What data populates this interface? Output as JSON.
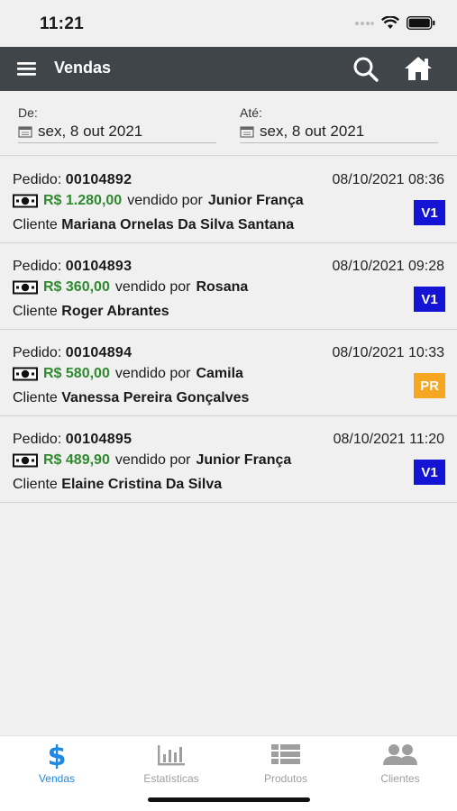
{
  "status": {
    "time": "11:21"
  },
  "header": {
    "title": "Vendas"
  },
  "filters": {
    "from": {
      "label": "De:",
      "value": "sex, 8 out 2021"
    },
    "to": {
      "label": "Até:",
      "value": "sex, 8 out 2021"
    }
  },
  "orders": [
    {
      "order_label": "Pedido:",
      "number": "00104892",
      "datetime": "08/10/2021 08:36",
      "price": "R$ 1.280,00",
      "sold_by_label": "vendido por",
      "seller": "Junior França",
      "client_label": "Cliente",
      "client": "Mariana Ornelas Da Silva Santana",
      "badge": "V1",
      "badge_color": "#1414d6"
    },
    {
      "order_label": "Pedido:",
      "number": "00104893",
      "datetime": "08/10/2021 09:28",
      "price": "R$ 360,00",
      "sold_by_label": "vendido por",
      "seller": "Rosana",
      "client_label": "Cliente",
      "client": "Roger Abrantes",
      "badge": "V1",
      "badge_color": "#1414d6"
    },
    {
      "order_label": "Pedido:",
      "number": "00104894",
      "datetime": "08/10/2021 10:33",
      "price": "R$ 580,00",
      "sold_by_label": "vendido por",
      "seller": "Camila",
      "client_label": "Cliente",
      "client": "Vanessa Pereira Gonçalves",
      "badge": "PR",
      "badge_color": "#f5a623"
    },
    {
      "order_label": "Pedido:",
      "number": "00104895",
      "datetime": "08/10/2021 11:20",
      "price": "R$ 489,90",
      "sold_by_label": "vendido por",
      "seller": "Junior França",
      "client_label": "Cliente",
      "client": "Elaine Cristina Da Silva",
      "badge": "V1",
      "badge_color": "#1414d6"
    }
  ],
  "tabs": [
    {
      "label": "Vendas",
      "icon": "dollar-icon",
      "active": true
    },
    {
      "label": "Estatísticas",
      "icon": "bar-chart-icon",
      "active": false
    },
    {
      "label": "Produtos",
      "icon": "list-icon",
      "active": false
    },
    {
      "label": "Clientes",
      "icon": "users-icon",
      "active": false
    }
  ],
  "colors": {
    "accent": "#1e88e5",
    "inactive": "#9e9e9e",
    "price": "#2f8a2f",
    "appbar": "#3f4549"
  }
}
